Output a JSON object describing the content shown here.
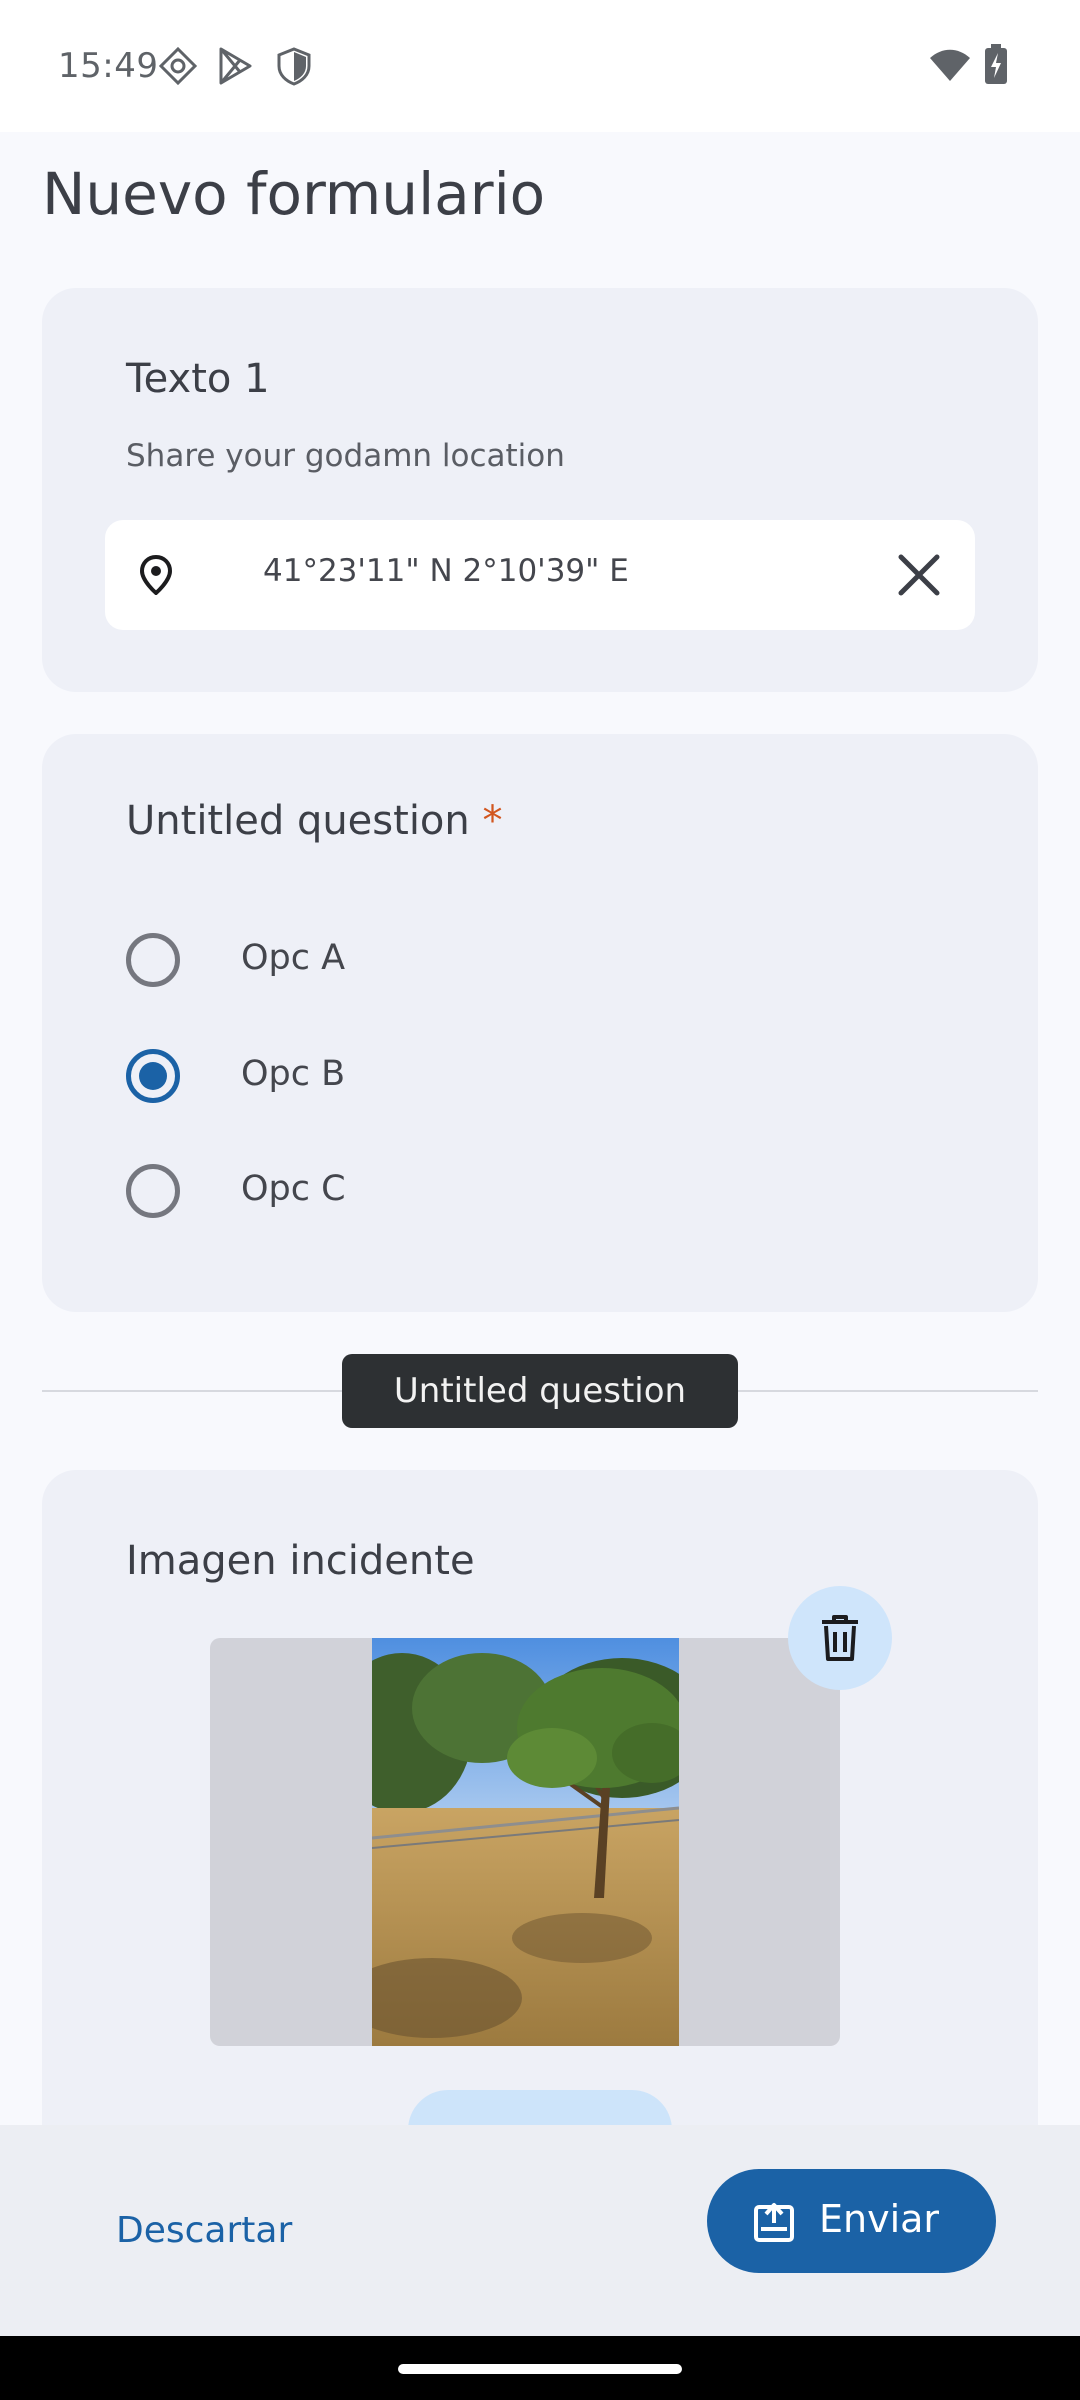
{
  "status_bar": {
    "time": "15:49",
    "left_icons": [
      "location-diamond-icon",
      "play-store-icon",
      "shield-icon"
    ],
    "right_icons": [
      "wifi-icon",
      "battery-charging-icon"
    ]
  },
  "page": {
    "title": "Nuevo formulario"
  },
  "text_question": {
    "title": "Texto 1",
    "description": "Share your godamn location",
    "location_value": "41°23'11\" N 2°10'39\" E",
    "icons": [
      "location-pin-icon",
      "close-icon"
    ]
  },
  "radio_question": {
    "title": "Untitled question",
    "required_mark": "*",
    "options": [
      {
        "label": "Opc A",
        "checked": false
      },
      {
        "label": "Opc B",
        "checked": true
      },
      {
        "label": "Opc C",
        "checked": false
      }
    ]
  },
  "tooltip": {
    "text": "Untitled question"
  },
  "image_question": {
    "title": "Imagen incidente",
    "image_description": "photo of a small tree on dry grass",
    "icons": [
      "delete-icon"
    ]
  },
  "bottom_bar": {
    "discard_label": "Descartar",
    "send_label": "Enviar",
    "send_icon": "send-form-icon"
  },
  "colors": {
    "accent": "#1b62a6",
    "card_bg": "#eef0f7",
    "required": "#d2561f",
    "delete_bg": "#cfe5fb"
  }
}
